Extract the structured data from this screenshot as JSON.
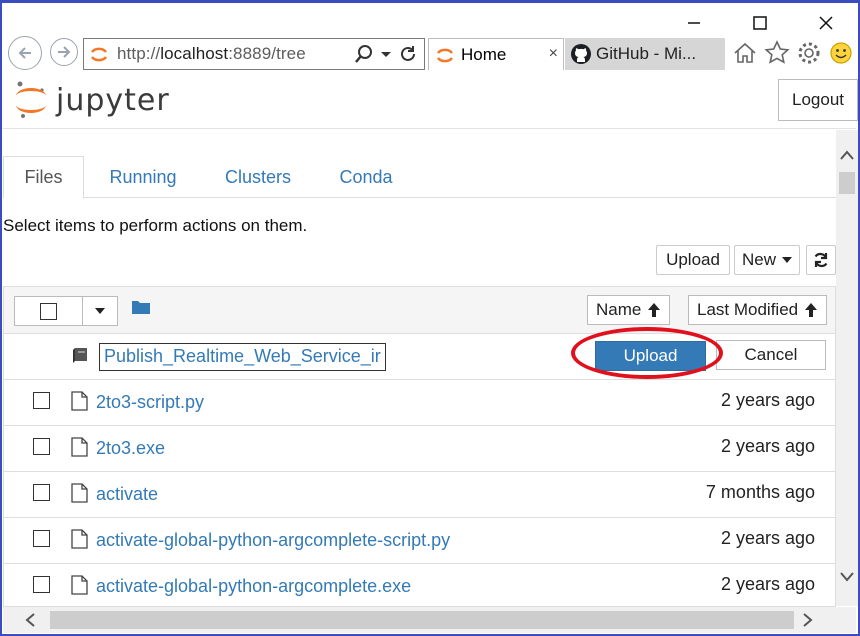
{
  "browser": {
    "url_prefix": "http://",
    "url_host": "localhost",
    "url_rest": ":8889/tree",
    "tabs": [
      {
        "label": "Home",
        "close": "×"
      },
      {
        "label": "GitHub - Mi..."
      }
    ]
  },
  "jupyter": {
    "logo_text": "jupyter",
    "logout_label": "Logout",
    "tabs": [
      {
        "label": "Files"
      },
      {
        "label": "Running"
      },
      {
        "label": "Clusters"
      },
      {
        "label": "Conda"
      }
    ],
    "hint": "Select items to perform actions on them.",
    "toolbar": {
      "upload_label": "Upload",
      "new_label": "New"
    },
    "list_header": {
      "name_sort": "Name",
      "modified_sort": "Last Modified"
    },
    "pending_upload": {
      "filename": "Publish_Realtime_Web_Service_ir",
      "upload_label": "Upload",
      "cancel_label": "Cancel"
    },
    "files": [
      {
        "name": "2to3-script.py",
        "modified": "2 years ago"
      },
      {
        "name": "2to3.exe",
        "modified": "2 years ago"
      },
      {
        "name": "activate",
        "modified": "7 months ago"
      },
      {
        "name": "activate-global-python-argcomplete-script.py",
        "modified": "2 years ago"
      },
      {
        "name": "activate-global-python-argcomplete.exe",
        "modified": "2 years ago"
      }
    ]
  },
  "colors": {
    "link": "#337ab7",
    "primary_button": "#337ab7",
    "highlight_circle": "#e0101c",
    "jupyter_orange": "#f37726"
  }
}
